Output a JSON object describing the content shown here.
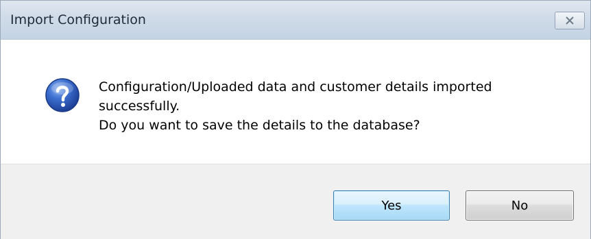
{
  "dialog": {
    "title": "Import Configuration",
    "close_icon": "close-icon",
    "icon": "question-icon",
    "message_lines": [
      "Configuration/Uploaded data and customer details imported",
      "successfully.",
      "Do you want to save the details to the database?"
    ]
  },
  "buttons": {
    "yes_label": "Yes",
    "no_label": "No"
  },
  "colors": {
    "titlebar": "#cfdbe8",
    "icon_blue": "#2a57b4",
    "footer": "#f0f0f0",
    "default_button_border": "#3c7fb1"
  }
}
